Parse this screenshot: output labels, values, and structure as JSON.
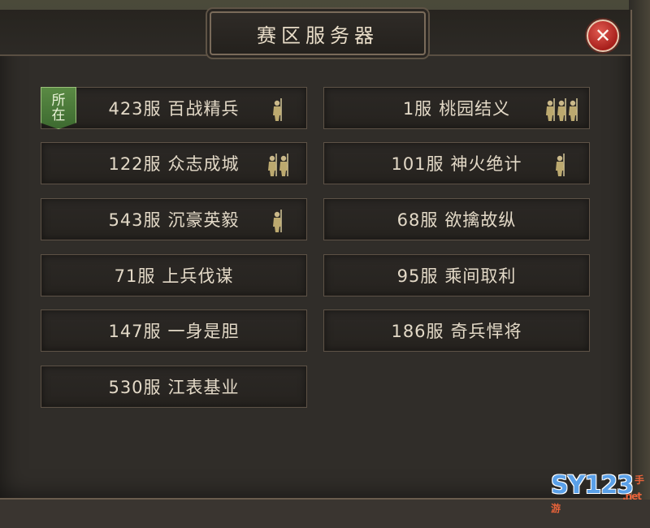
{
  "dialog": {
    "title": "赛区服务器",
    "close_icon": "close-icon"
  },
  "current_badge": {
    "line1": "所",
    "line2": "在"
  },
  "servers": [
    {
      "num": "423服",
      "name": "百战精兵",
      "soldiers": 1,
      "current": true
    },
    {
      "num": "1服",
      "name": "桃园结义",
      "soldiers": 3
    },
    {
      "num": "122服",
      "name": "众志成城",
      "soldiers": 2
    },
    {
      "num": "101服",
      "name": "神火绝计",
      "soldiers": 1
    },
    {
      "num": "543服",
      "name": "沉豪英毅",
      "soldiers": 1
    },
    {
      "num": "68服",
      "name": "欲擒故纵",
      "soldiers": 0
    },
    {
      "num": "71服",
      "name": "上兵伐谋",
      "soldiers": 0
    },
    {
      "num": "95服",
      "name": "乘间取利",
      "soldiers": 0
    },
    {
      "num": "147服",
      "name": "一身是胆",
      "soldiers": 0
    },
    {
      "num": "186服",
      "name": "奇兵悍将",
      "soldiers": 0
    },
    {
      "num": "530服",
      "name": "江表基业",
      "soldiers": 0
    }
  ],
  "watermark": {
    "main": "SY123",
    "cn": "手游",
    "net": ".net"
  }
}
